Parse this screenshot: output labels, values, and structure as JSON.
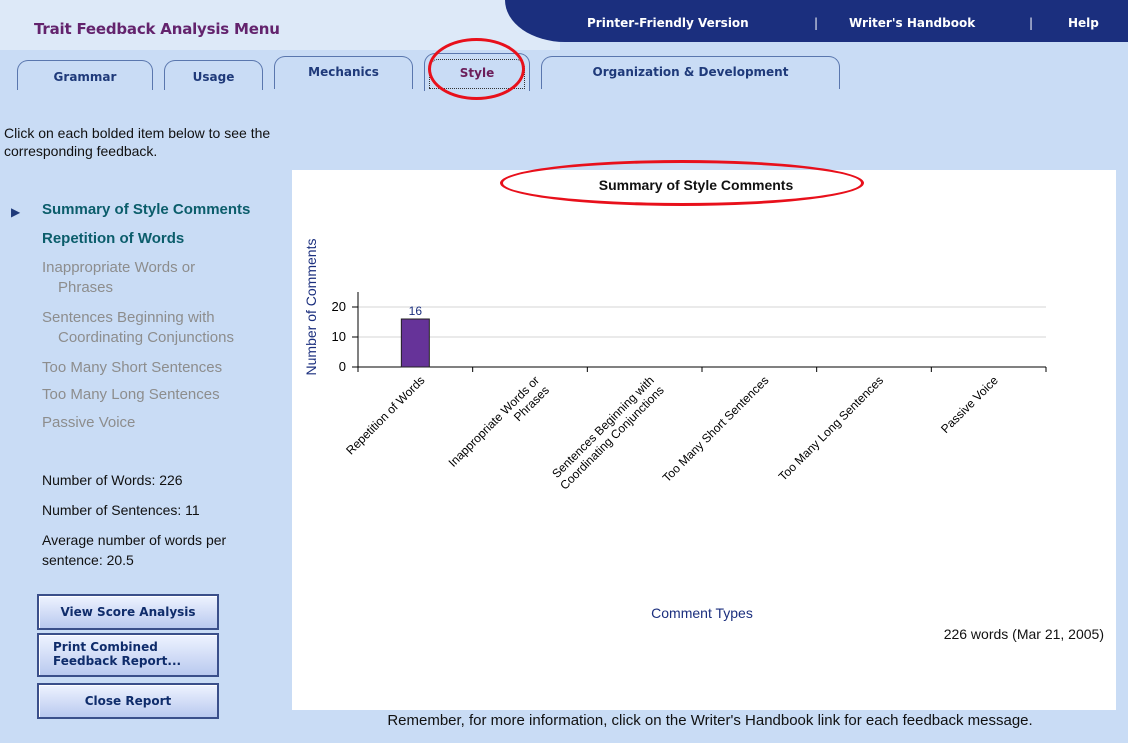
{
  "app": {
    "title": "Trait Feedback Analysis Menu",
    "links": {
      "printer": "Printer-Friendly Version",
      "separator": "|",
      "handbook": "Writer's Handbook",
      "help": "Help"
    }
  },
  "tabs": [
    {
      "label": "Grammar",
      "active": false
    },
    {
      "label": "Usage",
      "active": false
    },
    {
      "label": "Mechanics",
      "active": false
    },
    {
      "label": "Style",
      "active": true
    },
    {
      "label": "Organization & Development",
      "active": false
    }
  ],
  "sidebar": {
    "intro": "Click on each bolded item below to see the corresponding feedback.",
    "items": [
      {
        "label": "Summary of Style Comments",
        "state": "selected"
      },
      {
        "label": "Repetition of Words",
        "state": "bold"
      },
      {
        "label": "Inappropriate Words or",
        "sub": "Phrases",
        "state": "dim"
      },
      {
        "label": "Sentences Beginning with",
        "sub": "Coordinating Conjunctions",
        "state": "dim"
      },
      {
        "label": "Too Many Short Sentences",
        "state": "dim"
      },
      {
        "label": "Too Many Long Sentences",
        "state": "dim"
      },
      {
        "label": "Passive Voice",
        "state": "dim"
      }
    ],
    "stats": {
      "words": "Number of Words: 226",
      "sentences": "Number of Sentences: 11",
      "avg_line1": "Average number of words per",
      "avg_line2": "sentence: 20.5"
    },
    "buttons": {
      "score": "View Score Analysis",
      "print_line1": "Print Combined",
      "print_line2": "Feedback Report...",
      "close": "Close Report"
    }
  },
  "chart_data": {
    "type": "bar",
    "title": "Summary of Style Comments",
    "xlabel": "Comment Types",
    "ylabel": "Number of Comments",
    "ylim": [
      0,
      24
    ],
    "yticks": [
      0,
      10,
      20
    ],
    "grid": true,
    "categories": [
      [
        "Repetition of Words"
      ],
      [
        "Inappropriate Words or",
        "Phrases"
      ],
      [
        "Sentences Beginning with",
        "Coordinating Conjunctions"
      ],
      [
        "Too Many Short Sentences"
      ],
      [
        "Too Many Long Sentences"
      ],
      [
        "Passive Voice"
      ]
    ],
    "values": [
      16,
      0,
      0,
      0,
      0,
      0
    ],
    "data_labels": [
      "16",
      "",
      "",
      "",
      "",
      ""
    ],
    "bar_color": "#663399",
    "axis_text_color": "#1b2f7e"
  },
  "panel": {
    "word_count": "226 words (Mar 21, 2005)"
  },
  "footer": {
    "note": "Remember, for more information, click on the Writer's Handbook link for each feedback message."
  },
  "colors": {
    "highlight_circle": "#e8101b",
    "nav_bar": "#1b2f7e",
    "background": "#c9dcf5"
  }
}
